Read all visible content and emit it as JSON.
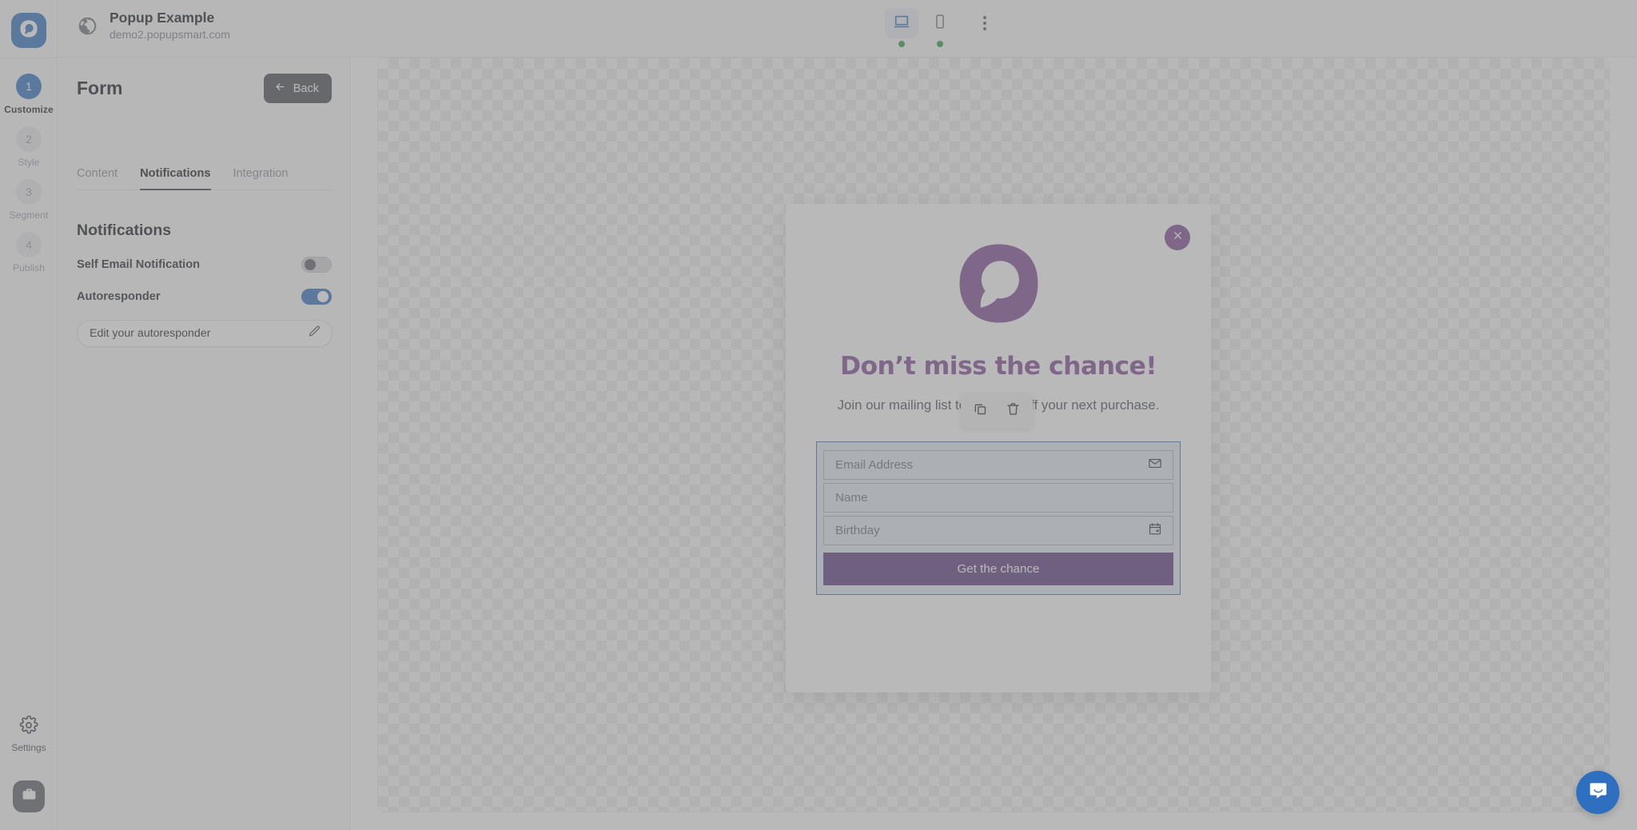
{
  "app": {
    "logo_icon": "popupsmart-logo-icon",
    "site_title": "Popup Example",
    "site_url": "demo2.popupsmart.com",
    "globe_icon": "globe-icon"
  },
  "rail": {
    "steps": [
      {
        "number": "1",
        "label": "Customize",
        "active": true
      },
      {
        "number": "2",
        "label": "Style",
        "active": false
      },
      {
        "number": "3",
        "label": "Segment",
        "active": false
      },
      {
        "number": "4",
        "label": "Publish",
        "active": false
      }
    ],
    "settings_label": "Settings",
    "settings_icon": "gear-icon",
    "workspace_icon": "briefcase-icon"
  },
  "toolbar": {
    "desktop_icon": "desktop-monitor-icon",
    "mobile_icon": "mobile-phone-icon",
    "more_icon": "kebab-menu-icon",
    "desktop_active": true,
    "desktop_status": "online",
    "mobile_status": "online"
  },
  "panel": {
    "title": "Form",
    "back_label": "Back",
    "back_icon": "arrow-left-icon",
    "tabs": [
      {
        "label": "Content",
        "active": false
      },
      {
        "label": "Notifications",
        "active": true
      },
      {
        "label": "Integration",
        "active": false
      }
    ],
    "section_title": "Notifications",
    "options": [
      {
        "label": "Self Email Notification",
        "on": false
      },
      {
        "label": "Autoresponder",
        "on": true
      }
    ],
    "edit_field": {
      "text": "Edit your autoresponder",
      "icon": "pencil-edit-icon"
    }
  },
  "popup": {
    "close_icon": "close-x-icon",
    "close_color": "#7e4b96",
    "logo_icon": "popupsmart-purple-logo-icon",
    "logo_color": "#7e4b96",
    "heading": "Don’t miss the chance!",
    "heading_color": "#7e4b96",
    "subtext": "Join our mailing list to get 15% off your next purchase.",
    "fields": [
      {
        "placeholder": "Email Address",
        "icon": "envelope-icon"
      },
      {
        "placeholder": "Name",
        "icon": ""
      },
      {
        "placeholder": "Birthday",
        "icon": "calendar-icon"
      }
    ],
    "submit_label": "Get the chance",
    "submit_color": "#5c3b80",
    "selection_border_color": "#3a73c4"
  },
  "float_toolbar": {
    "duplicate_icon": "copy-duplicate-icon",
    "delete_icon": "trash-delete-icon"
  },
  "chat": {
    "icon": "chat-bubble-icon",
    "color": "#2f6fc0"
  }
}
